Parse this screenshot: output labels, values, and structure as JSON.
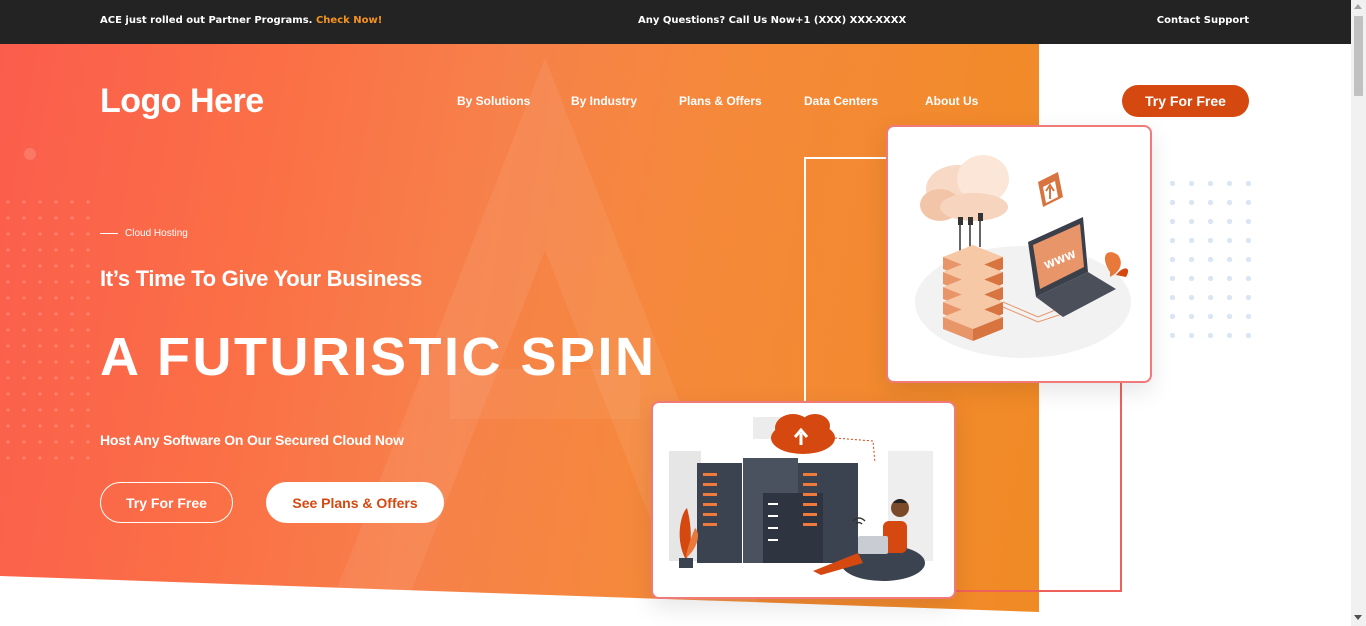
{
  "topbar": {
    "announcement": "ACE just rolled out Partner Programs.",
    "announcement_link": "Check Now!",
    "contact_line": "Any Questions? Call Us Now+1 (XXX) XXX-XXXX",
    "support_link": "Contact Support"
  },
  "header": {
    "logo": "Logo Here",
    "nav": [
      "By Solutions",
      "By Industry",
      "Plans & Offers",
      "Data Centers",
      "About Us"
    ],
    "cta": "Try For Free"
  },
  "hero": {
    "eyebrow": "Cloud Hosting",
    "subtitle": "It’s Time To Give Your Business",
    "title": "A FUTURISTIC SPIN",
    "description": "Host Any Software On Our Secured Cloud Now",
    "btn_primary": "Try For Free",
    "btn_secondary": "See Plans & Offers"
  },
  "illustrations": {
    "card1_text": "WWW"
  },
  "colors": {
    "accent": "#d5480f",
    "topbar_bg": "#232323",
    "link_orange": "#f7931e",
    "card_border": "#f07a7a"
  }
}
